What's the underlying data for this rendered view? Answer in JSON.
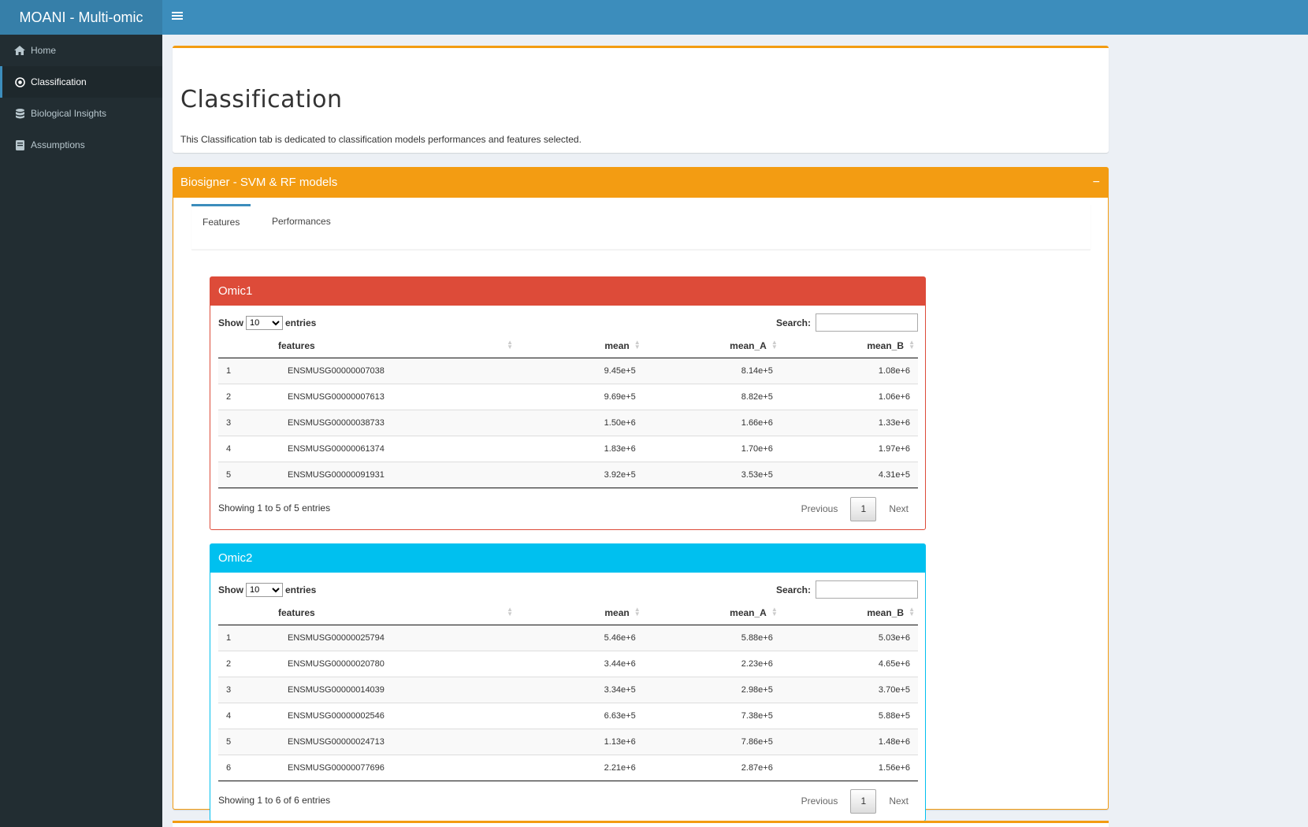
{
  "app": {
    "title": "MOANI - Multi-omic"
  },
  "sidebar": {
    "items": [
      {
        "label": "Home",
        "icon": "home-icon"
      },
      {
        "label": "Classification",
        "icon": "target-icon"
      },
      {
        "label": "Biological Insights",
        "icon": "database-icon"
      },
      {
        "label": "Assumptions",
        "icon": "book-icon"
      }
    ]
  },
  "page": {
    "title": "Classification",
    "description": "This Classification tab is dedicated to classification models performances and features selected."
  },
  "model_box": {
    "title": "Biosigner - SVM & RF models",
    "collapse_icon": "−",
    "tabs": [
      {
        "label": "Features"
      },
      {
        "label": "Performances"
      }
    ]
  },
  "tables_common": {
    "show": "Show",
    "entries": "entries",
    "page_size": "10",
    "search_label": "Search:",
    "columns": [
      "features",
      "mean",
      "mean_A",
      "mean_B"
    ],
    "previous": "Previous",
    "next": "Next",
    "page": "1"
  },
  "omic1": {
    "title": "Omic1",
    "info": "Showing 1 to 5 of 5 entries",
    "rows": [
      [
        "1",
        "ENSMUSG00000007038",
        "9.45e+5",
        "8.14e+5",
        "1.08e+6"
      ],
      [
        "2",
        "ENSMUSG00000007613",
        "9.69e+5",
        "8.82e+5",
        "1.06e+6"
      ],
      [
        "3",
        "ENSMUSG00000038733",
        "1.50e+6",
        "1.66e+6",
        "1.33e+6"
      ],
      [
        "4",
        "ENSMUSG00000061374",
        "1.83e+6",
        "1.70e+6",
        "1.97e+6"
      ],
      [
        "5",
        "ENSMUSG00000091931",
        "3.92e+5",
        "3.53e+5",
        "4.31e+5"
      ]
    ]
  },
  "omic2": {
    "title": "Omic2",
    "info": "Showing 1 to 6 of 6 entries",
    "rows": [
      [
        "1",
        "ENSMUSG00000025794",
        "5.46e+6",
        "5.88e+6",
        "5.03e+6"
      ],
      [
        "2",
        "ENSMUSG00000020780",
        "3.44e+6",
        "2.23e+6",
        "4.65e+6"
      ],
      [
        "3",
        "ENSMUSG00000014039",
        "3.34e+5",
        "2.98e+5",
        "3.70e+5"
      ],
      [
        "4",
        "ENSMUSG00000002546",
        "6.63e+5",
        "7.38e+5",
        "5.88e+5"
      ],
      [
        "5",
        "ENSMUSG00000024713",
        "1.13e+6",
        "7.86e+5",
        "1.48e+6"
      ],
      [
        "6",
        "ENSMUSG00000077696",
        "2.21e+6",
        "2.87e+6",
        "1.56e+6"
      ]
    ]
  },
  "colors": {
    "header": "#3c8dbc",
    "sidebar": "#222d32",
    "warning": "#f39c12",
    "danger": "#dd4b39",
    "info": "#00c0ef"
  }
}
